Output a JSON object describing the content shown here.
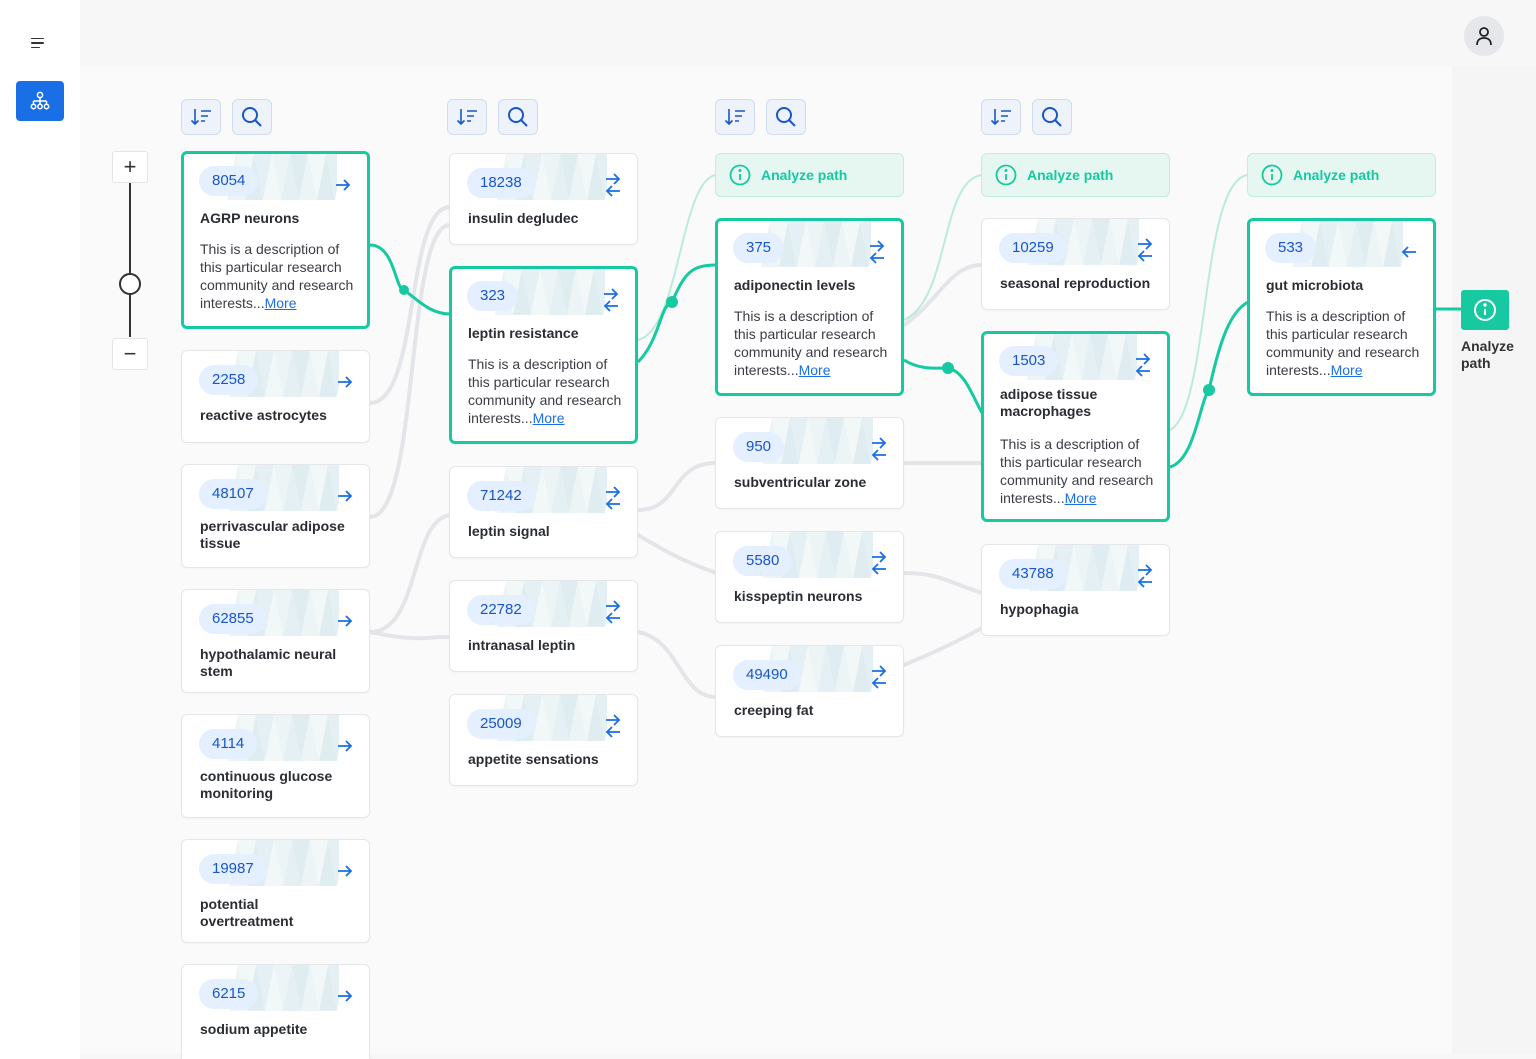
{
  "colors": {
    "accent": "#16c9a0",
    "primary": "#1a6fe6",
    "badge_bg": "#e4efff",
    "link_gray": "#e3e5e9"
  },
  "sidebar": {
    "menu_icon": "menu-icon",
    "active_item_icon": "network-graph-icon"
  },
  "header": {
    "avatar_icon": "user-icon"
  },
  "zoom": {
    "in_label": "+",
    "out_label": "−"
  },
  "analyze": {
    "label": "Analyze path",
    "final_label": "Analyze path"
  },
  "more_label": "More",
  "description": "This is a description of this particular research community and research interests...",
  "columns": [
    {
      "nodes": [
        {
          "count": "8054",
          "title": "AGRP neurons",
          "arrow": "right"
        },
        {
          "count": "2258",
          "title": "reactive astrocytes",
          "arrow": "right"
        },
        {
          "count": "48107",
          "title": "perrivascular adipose tissue",
          "arrow": "right"
        },
        {
          "count": "62855",
          "title": "hypothalamic neural stem",
          "arrow": "right"
        },
        {
          "count": "4114",
          "title": "continuous glucose monitoring",
          "arrow": "right"
        },
        {
          "count": "19987",
          "title": "potential overtreatment",
          "arrow": "right"
        },
        {
          "count": "6215",
          "title": "sodium appetite",
          "arrow": "right"
        }
      ]
    },
    {
      "nodes": [
        {
          "count": "18238",
          "title": "insulin degludec",
          "arrow": "both"
        },
        {
          "count": "323",
          "title": "leptin resistance",
          "arrow": "both"
        },
        {
          "count": "71242",
          "title": "leptin signal",
          "arrow": "both"
        },
        {
          "count": "22782",
          "title": "intranasal leptin",
          "arrow": "both"
        },
        {
          "count": "25009",
          "title": "appetite sensations",
          "arrow": "both"
        }
      ]
    },
    {
      "nodes": [
        {
          "count": "375",
          "title": "adiponectin levels",
          "arrow": "both"
        },
        {
          "count": "950",
          "title": "subventricular zone",
          "arrow": "both"
        },
        {
          "count": "5580",
          "title": "kisspeptin neurons",
          "arrow": "both"
        },
        {
          "count": "49490",
          "title": "creeping fat",
          "arrow": "both"
        }
      ]
    },
    {
      "nodes": [
        {
          "count": "10259",
          "title": "seasonal reproduction",
          "arrow": "both"
        },
        {
          "count": "1503",
          "title": "adipose tissue macrophages",
          "arrow": "both"
        },
        {
          "count": "43788",
          "title": "hypophagia",
          "arrow": "both"
        }
      ]
    },
    {
      "nodes": [
        {
          "count": "533",
          "title": "gut microbiota",
          "arrow": "left"
        }
      ]
    }
  ]
}
